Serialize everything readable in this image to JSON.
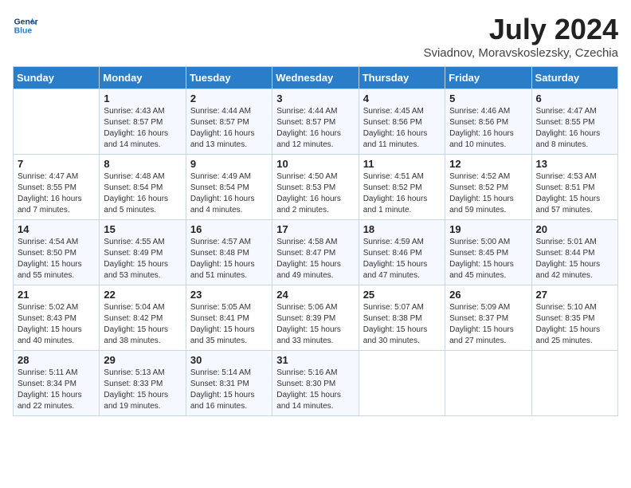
{
  "header": {
    "logo_line1": "General",
    "logo_line2": "Blue",
    "month_year": "July 2024",
    "location": "Sviadnov, Moravskoslezsky, Czechia"
  },
  "days_of_week": [
    "Sunday",
    "Monday",
    "Tuesday",
    "Wednesday",
    "Thursday",
    "Friday",
    "Saturday"
  ],
  "weeks": [
    [
      {
        "day": "",
        "info": ""
      },
      {
        "day": "1",
        "info": "Sunrise: 4:43 AM\nSunset: 8:57 PM\nDaylight: 16 hours\nand 14 minutes."
      },
      {
        "day": "2",
        "info": "Sunrise: 4:44 AM\nSunset: 8:57 PM\nDaylight: 16 hours\nand 13 minutes."
      },
      {
        "day": "3",
        "info": "Sunrise: 4:44 AM\nSunset: 8:57 PM\nDaylight: 16 hours\nand 12 minutes."
      },
      {
        "day": "4",
        "info": "Sunrise: 4:45 AM\nSunset: 8:56 PM\nDaylight: 16 hours\nand 11 minutes."
      },
      {
        "day": "5",
        "info": "Sunrise: 4:46 AM\nSunset: 8:56 PM\nDaylight: 16 hours\nand 10 minutes."
      },
      {
        "day": "6",
        "info": "Sunrise: 4:47 AM\nSunset: 8:55 PM\nDaylight: 16 hours\nand 8 minutes."
      }
    ],
    [
      {
        "day": "7",
        "info": "Sunrise: 4:47 AM\nSunset: 8:55 PM\nDaylight: 16 hours\nand 7 minutes."
      },
      {
        "day": "8",
        "info": "Sunrise: 4:48 AM\nSunset: 8:54 PM\nDaylight: 16 hours\nand 5 minutes."
      },
      {
        "day": "9",
        "info": "Sunrise: 4:49 AM\nSunset: 8:54 PM\nDaylight: 16 hours\nand 4 minutes."
      },
      {
        "day": "10",
        "info": "Sunrise: 4:50 AM\nSunset: 8:53 PM\nDaylight: 16 hours\nand 2 minutes."
      },
      {
        "day": "11",
        "info": "Sunrise: 4:51 AM\nSunset: 8:52 PM\nDaylight: 16 hours\nand 1 minute."
      },
      {
        "day": "12",
        "info": "Sunrise: 4:52 AM\nSunset: 8:52 PM\nDaylight: 15 hours\nand 59 minutes."
      },
      {
        "day": "13",
        "info": "Sunrise: 4:53 AM\nSunset: 8:51 PM\nDaylight: 15 hours\nand 57 minutes."
      }
    ],
    [
      {
        "day": "14",
        "info": "Sunrise: 4:54 AM\nSunset: 8:50 PM\nDaylight: 15 hours\nand 55 minutes."
      },
      {
        "day": "15",
        "info": "Sunrise: 4:55 AM\nSunset: 8:49 PM\nDaylight: 15 hours\nand 53 minutes."
      },
      {
        "day": "16",
        "info": "Sunrise: 4:57 AM\nSunset: 8:48 PM\nDaylight: 15 hours\nand 51 minutes."
      },
      {
        "day": "17",
        "info": "Sunrise: 4:58 AM\nSunset: 8:47 PM\nDaylight: 15 hours\nand 49 minutes."
      },
      {
        "day": "18",
        "info": "Sunrise: 4:59 AM\nSunset: 8:46 PM\nDaylight: 15 hours\nand 47 minutes."
      },
      {
        "day": "19",
        "info": "Sunrise: 5:00 AM\nSunset: 8:45 PM\nDaylight: 15 hours\nand 45 minutes."
      },
      {
        "day": "20",
        "info": "Sunrise: 5:01 AM\nSunset: 8:44 PM\nDaylight: 15 hours\nand 42 minutes."
      }
    ],
    [
      {
        "day": "21",
        "info": "Sunrise: 5:02 AM\nSunset: 8:43 PM\nDaylight: 15 hours\nand 40 minutes."
      },
      {
        "day": "22",
        "info": "Sunrise: 5:04 AM\nSunset: 8:42 PM\nDaylight: 15 hours\nand 38 minutes."
      },
      {
        "day": "23",
        "info": "Sunrise: 5:05 AM\nSunset: 8:41 PM\nDaylight: 15 hours\nand 35 minutes."
      },
      {
        "day": "24",
        "info": "Sunrise: 5:06 AM\nSunset: 8:39 PM\nDaylight: 15 hours\nand 33 minutes."
      },
      {
        "day": "25",
        "info": "Sunrise: 5:07 AM\nSunset: 8:38 PM\nDaylight: 15 hours\nand 30 minutes."
      },
      {
        "day": "26",
        "info": "Sunrise: 5:09 AM\nSunset: 8:37 PM\nDaylight: 15 hours\nand 27 minutes."
      },
      {
        "day": "27",
        "info": "Sunrise: 5:10 AM\nSunset: 8:35 PM\nDaylight: 15 hours\nand 25 minutes."
      }
    ],
    [
      {
        "day": "28",
        "info": "Sunrise: 5:11 AM\nSunset: 8:34 PM\nDaylight: 15 hours\nand 22 minutes."
      },
      {
        "day": "29",
        "info": "Sunrise: 5:13 AM\nSunset: 8:33 PM\nDaylight: 15 hours\nand 19 minutes."
      },
      {
        "day": "30",
        "info": "Sunrise: 5:14 AM\nSunset: 8:31 PM\nDaylight: 15 hours\nand 16 minutes."
      },
      {
        "day": "31",
        "info": "Sunrise: 5:16 AM\nSunset: 8:30 PM\nDaylight: 15 hours\nand 14 minutes."
      },
      {
        "day": "",
        "info": ""
      },
      {
        "day": "",
        "info": ""
      },
      {
        "day": "",
        "info": ""
      }
    ]
  ]
}
